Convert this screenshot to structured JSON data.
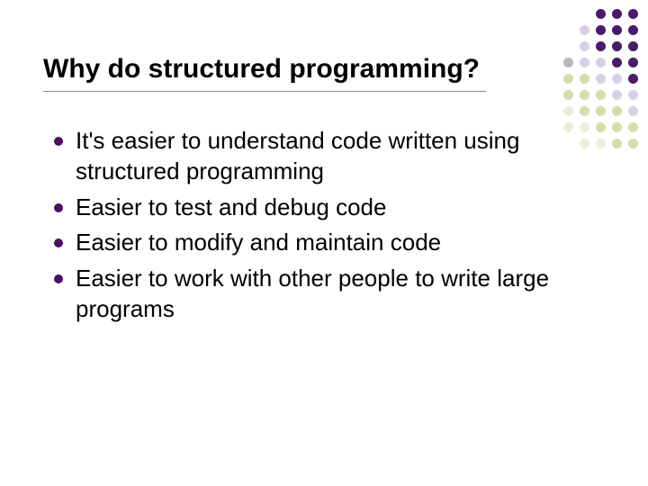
{
  "slide": {
    "title": "Why do structured programming?",
    "bullets": [
      "It's easier to understand code written using structured programming",
      "Easier to test and debug code",
      "Easier to modify and maintain code",
      "Easier to work with other people to write large programs"
    ]
  }
}
